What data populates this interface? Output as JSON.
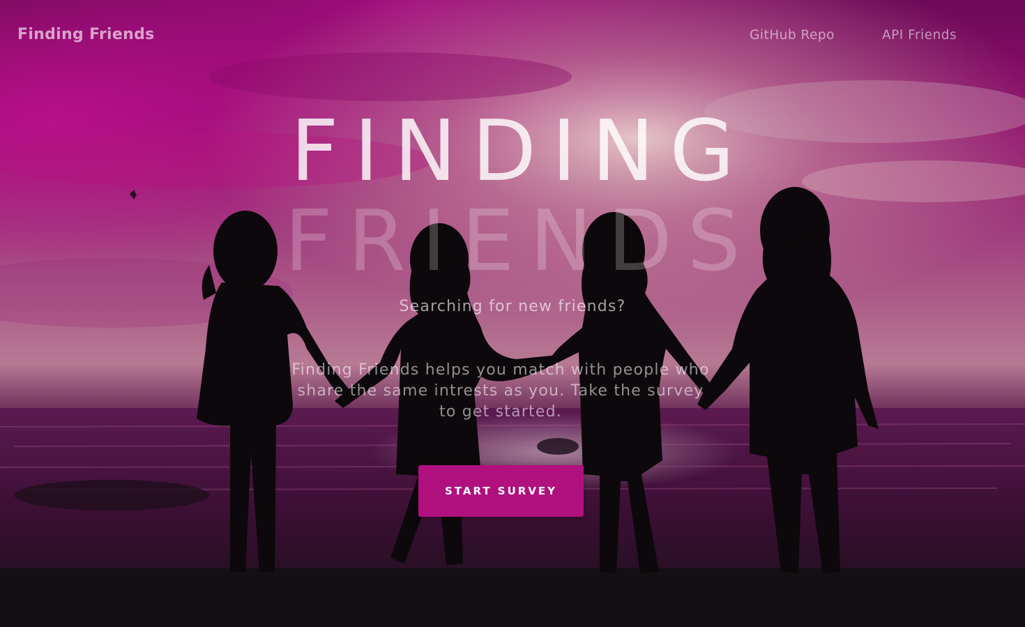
{
  "navbar": {
    "brand": "Finding Friends",
    "links": [
      {
        "label": "GitHub Repo"
      },
      {
        "label": "API Friends"
      }
    ]
  },
  "hero": {
    "headline_line1": "FINDING",
    "headline_line2": "FRIENDS",
    "subheading": "Searching for new friends?",
    "description": "Finding Friends helps you match with people who share the same intrests as you. Take the survey to get started.",
    "cta_label": "START SURVEY"
  },
  "colors": {
    "accent": "#b0117f",
    "sky_magenta": "#9c0a78",
    "sky_glow": "#e8d2c4",
    "silhouette": "#0c080b"
  },
  "background": {
    "scene": "four-girls-holding-hands-silhouette-sunset-sea"
  }
}
